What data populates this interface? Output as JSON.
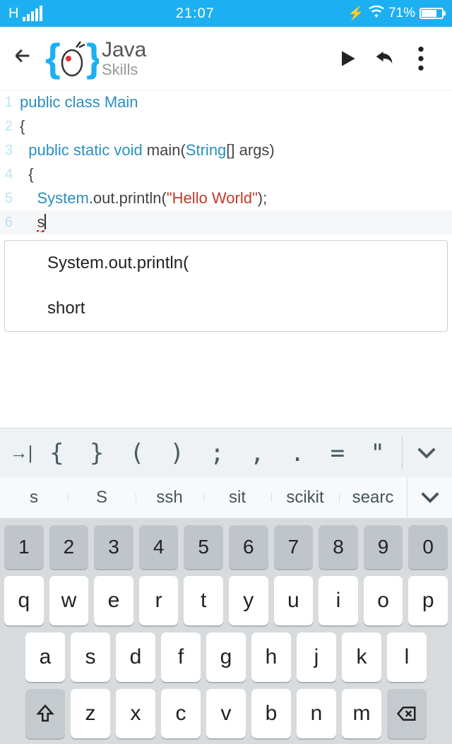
{
  "status": {
    "carrier": "H",
    "time": "21:07",
    "battery_pct": "71%"
  },
  "appbar": {
    "title": "Java",
    "subtitle": "Skills"
  },
  "code": {
    "lines": [
      {
        "n": "1",
        "indent": "",
        "html": "<span class='kw'>public</span> <span class='kw'>class</span> <span class='cls'>Main</span>"
      },
      {
        "n": "2",
        "indent": "",
        "html": "{"
      },
      {
        "n": "3",
        "indent": "  ",
        "html": "<span class='kw'>public</span> <span class='kw'>static</span> <span class='typ'>void</span> main(<span class='typ'>String</span>[] args)"
      },
      {
        "n": "4",
        "indent": "  ",
        "html": "{"
      },
      {
        "n": "5",
        "indent": "    ",
        "html": "<span class='id'>System</span>.out.println(<span class='str'>\"Hello World\"</span>);"
      },
      {
        "n": "6",
        "indent": "    ",
        "html": "<span class='err'>s</span><span class='cursor'></span>",
        "hl": true
      }
    ]
  },
  "autocomplete": {
    "items": [
      "System.out.println(",
      "short"
    ]
  },
  "symbols": [
    "{",
    "}",
    "(",
    ")",
    ";",
    ",",
    ".",
    "=",
    "\""
  ],
  "suggestions": [
    "s",
    "S",
    "ssh",
    "sit",
    "scikit",
    "searc"
  ],
  "keyboard": {
    "row_num": [
      "1",
      "2",
      "3",
      "4",
      "5",
      "6",
      "7",
      "8",
      "9",
      "0"
    ],
    "row1": [
      "q",
      "w",
      "e",
      "r",
      "t",
      "y",
      "u",
      "i",
      "o",
      "p"
    ],
    "row2": [
      "a",
      "s",
      "d",
      "f",
      "g",
      "h",
      "j",
      "k",
      "l"
    ],
    "row3": [
      "z",
      "x",
      "c",
      "v",
      "b",
      "n",
      "m"
    ]
  }
}
